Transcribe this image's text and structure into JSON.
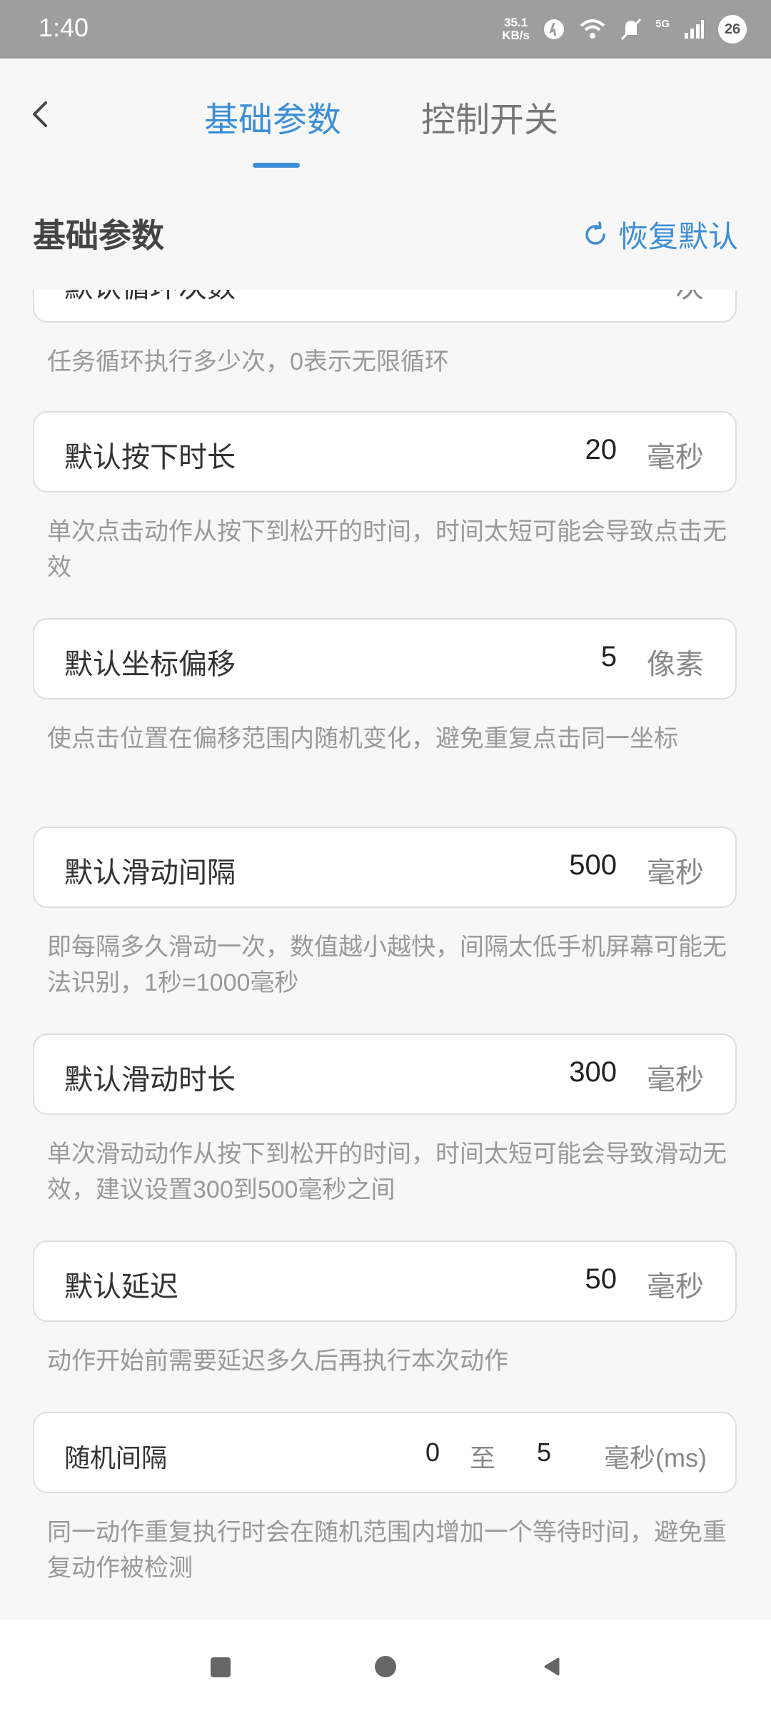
{
  "status_bar": {
    "time": "1:40",
    "net_speed_value": "35.1",
    "net_speed_unit": "KB/s",
    "network": "5G",
    "battery": "26"
  },
  "header": {
    "tabs": [
      {
        "label": "基础参数",
        "active": true
      },
      {
        "label": "控制开关",
        "active": false
      }
    ]
  },
  "section": {
    "title": "基础参数",
    "restore_label": "恢复默认"
  },
  "params": [
    {
      "label": "默认循环次数",
      "value": "",
      "unit": "次",
      "description": "任务循环执行多少次，0表示无限循环"
    },
    {
      "label": "默认按下时长",
      "value": "20",
      "unit": "毫秒",
      "description": "单次点击动作从按下到松开的时间，时间太短可能会导致点击无效"
    },
    {
      "label": "默认坐标偏移",
      "value": "5",
      "unit": "像素",
      "description": "使点击位置在偏移范围内随机变化，避免重复点击同一坐标"
    },
    {
      "label": "默认滑动间隔",
      "value": "500",
      "unit": "毫秒",
      "description": "即每隔多久滑动一次，数值越小越快，间隔太低手机屏幕可能无法识别，1秒=1000毫秒"
    },
    {
      "label": "默认滑动时长",
      "value": "300",
      "unit": "毫秒",
      "description": "单次滑动动作从按下到松开的时间，时间太短可能会导致滑动无效，建议设置300到500毫秒之间"
    },
    {
      "label": "默认延迟",
      "value": "50",
      "unit": "毫秒",
      "description": "动作开始前需要延迟多久后再执行本次动作"
    }
  ],
  "random_interval": {
    "label": "随机间隔",
    "min": "0",
    "to": "至",
    "max": "5",
    "unit": "毫秒(ms)",
    "description": "同一动作重复执行时会在随机范围内增加一个等待时间，避免重复动作被检测"
  },
  "colors": {
    "accent": "#3c8fd6",
    "status_bar": "#9e9e9e",
    "background": "#f7f7f8"
  }
}
